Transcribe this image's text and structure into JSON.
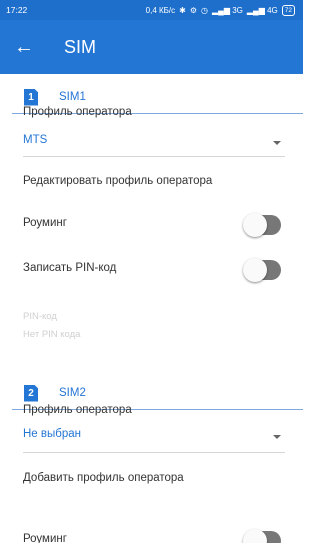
{
  "status_bar": {
    "time": "17:22",
    "speed": "0,4 КБ/с",
    "bluetooth_icon": "bluetooth-icon",
    "network_labels": "3G",
    "network_labels2": "4G",
    "battery": "72"
  },
  "app_bar": {
    "back_icon": "←",
    "title": "SIM"
  },
  "sim1": {
    "number": "1",
    "name": "SIM1",
    "operator_profile_label": "Профиль оператора",
    "operator_profile_value": "MTS",
    "edit_profile_label": "Редактировать профиль оператора",
    "roaming_label": "Роуминг",
    "roaming_on": false,
    "save_pin_label": "Записать PIN-код",
    "save_pin_on": false,
    "pin_label": "PIN-код",
    "pin_value": "Нет PIN кода"
  },
  "sim2": {
    "number": "2",
    "name": "SIM2",
    "operator_profile_label": "Профиль оператора",
    "operator_profile_value": "Не выбран",
    "add_profile_label": "Добавить профиль оператора",
    "roaming_label": "Роуминг",
    "roaming_on": false
  },
  "colors": {
    "accent": "#2476d4",
    "status_bar": "#1e6fcb"
  }
}
